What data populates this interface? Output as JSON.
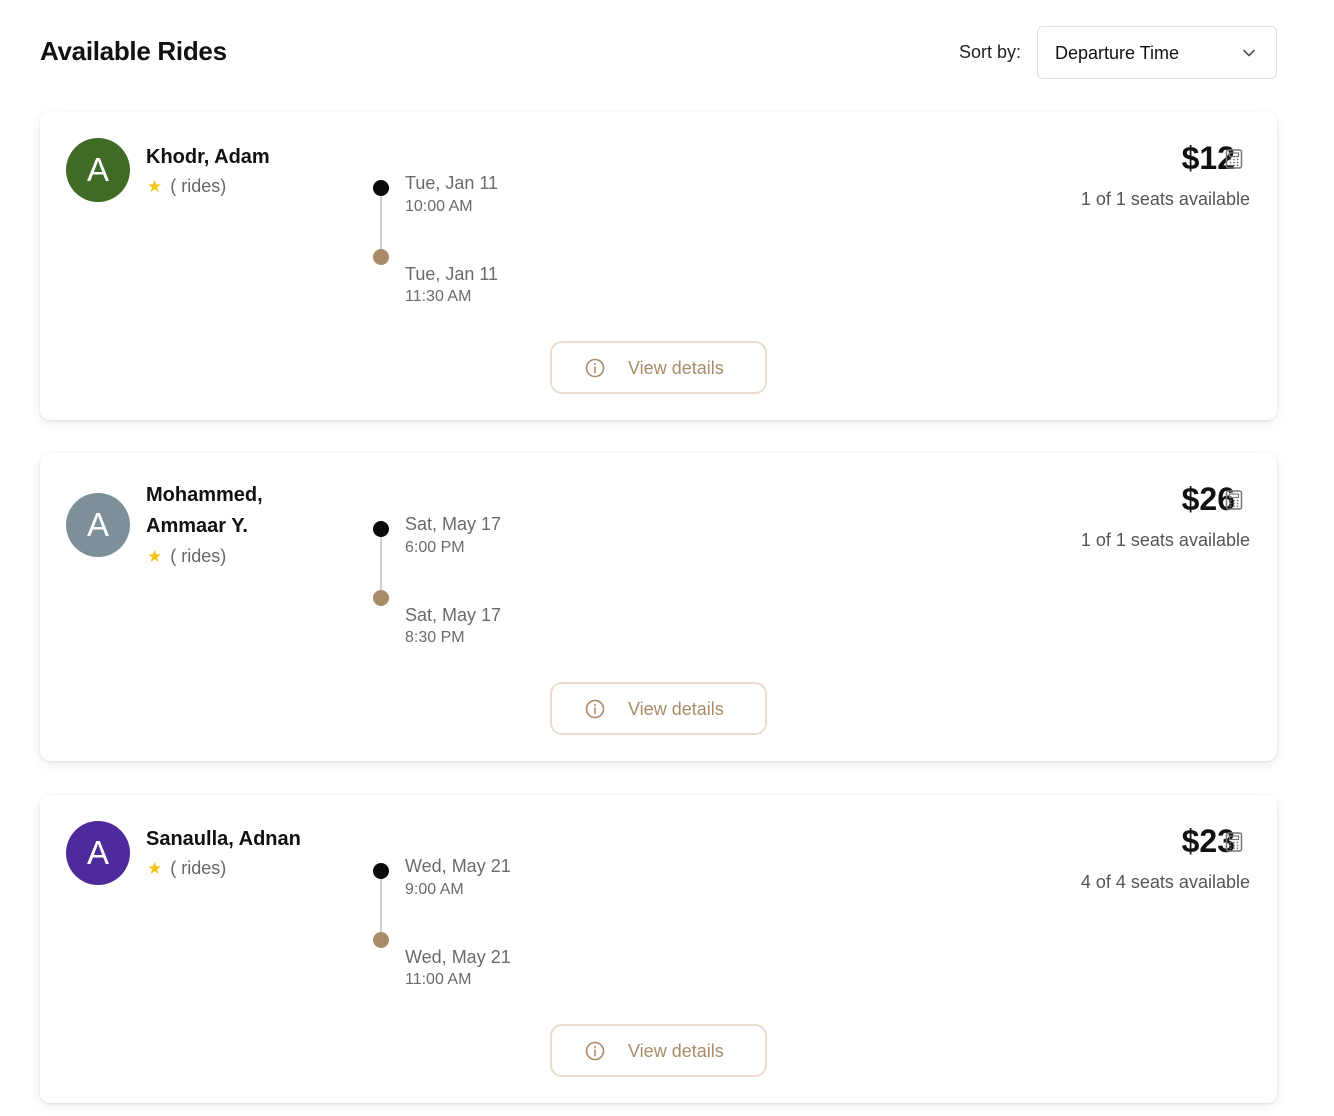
{
  "header": {
    "title": "Available Rides",
    "sort_label": "Sort by:",
    "sort_value": "Departure Time"
  },
  "colors": {
    "accent": "#a88c68",
    "start_dot": "#0a0a0a",
    "star": "#f5c518"
  },
  "rides": [
    {
      "avatar_letter": "A",
      "avatar_color": "#3f6b25",
      "name_line1": "Khodr, Adam",
      "name_line2": "",
      "rating_text": "( rides)",
      "departure_date": "Tue, Jan 11",
      "departure_time": "10:00 AM",
      "arrival_date": "Tue, Jan 11",
      "arrival_time": "11:30 AM",
      "price": "$12",
      "seats": "1 of 1 seats available",
      "button_label": "View details"
    },
    {
      "avatar_letter": "A",
      "avatar_color": "#7d8f99",
      "name_line1": "Mohammed,",
      "name_line2": "Ammaar Y.",
      "rating_text": "( rides)",
      "departure_date": "Sat, May 17",
      "departure_time": "6:00 PM",
      "arrival_date": "Sat, May 17",
      "arrival_time": "8:30 PM",
      "price": "$26",
      "seats": "1 of 1 seats available",
      "button_label": "View details"
    },
    {
      "avatar_letter": "A",
      "avatar_color": "#4e2a9c",
      "name_line1": "Sanaulla, Adnan",
      "name_line2": "",
      "rating_text": "( rides)",
      "departure_date": "Wed, May 21",
      "departure_time": "9:00 AM",
      "arrival_date": "Wed, May 21",
      "arrival_time": "11:00 AM",
      "price": "$23",
      "seats": "4 of 4 seats available",
      "button_label": "View details"
    }
  ]
}
